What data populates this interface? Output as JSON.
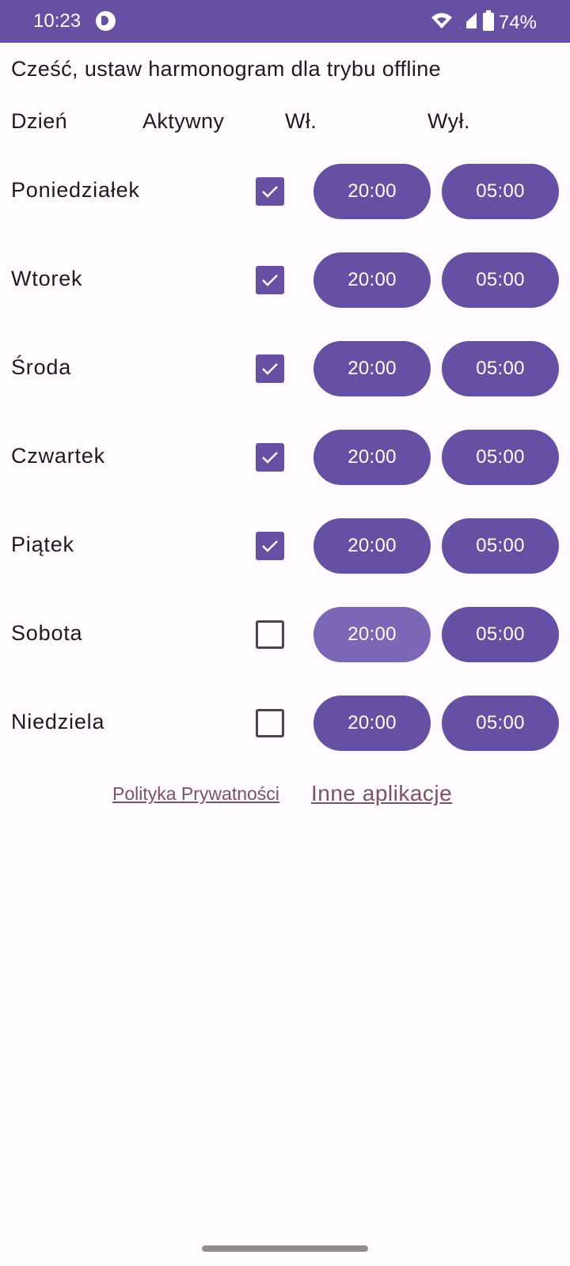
{
  "status_bar": {
    "time": "10:23",
    "battery": "74%",
    "icons": [
      "notification-app-icon",
      "wifi-icon",
      "signal-icon",
      "battery-icon"
    ]
  },
  "greeting": "Cześć, ustaw harmonogram dla trybu offline",
  "headers": {
    "day": "Dzień",
    "active": "Aktywny",
    "on": "Wł.",
    "off": "Wył."
  },
  "days": [
    {
      "name": "Poniedziałek",
      "active": true,
      "on_time": "20:00",
      "off_time": "05:00"
    },
    {
      "name": "Wtorek",
      "active": true,
      "on_time": "20:00",
      "off_time": "05:00"
    },
    {
      "name": "Środa",
      "active": true,
      "on_time": "20:00",
      "off_time": "05:00"
    },
    {
      "name": "Czwartek",
      "active": true,
      "on_time": "20:00",
      "off_time": "05:00"
    },
    {
      "name": "Piątek",
      "active": true,
      "on_time": "20:00",
      "off_time": "05:00"
    },
    {
      "name": "Sobota",
      "active": false,
      "on_time": "20:00",
      "off_time": "05:00"
    },
    {
      "name": "Niedziela",
      "active": false,
      "on_time": "20:00",
      "off_time": "05:00"
    }
  ],
  "footer": {
    "privacy_policy": "Polityka Prywatności",
    "other_apps": "Inne aplikacje"
  },
  "colors": {
    "primary": "#6750a4",
    "background": "#fffbfe",
    "link": "#7d5260"
  }
}
